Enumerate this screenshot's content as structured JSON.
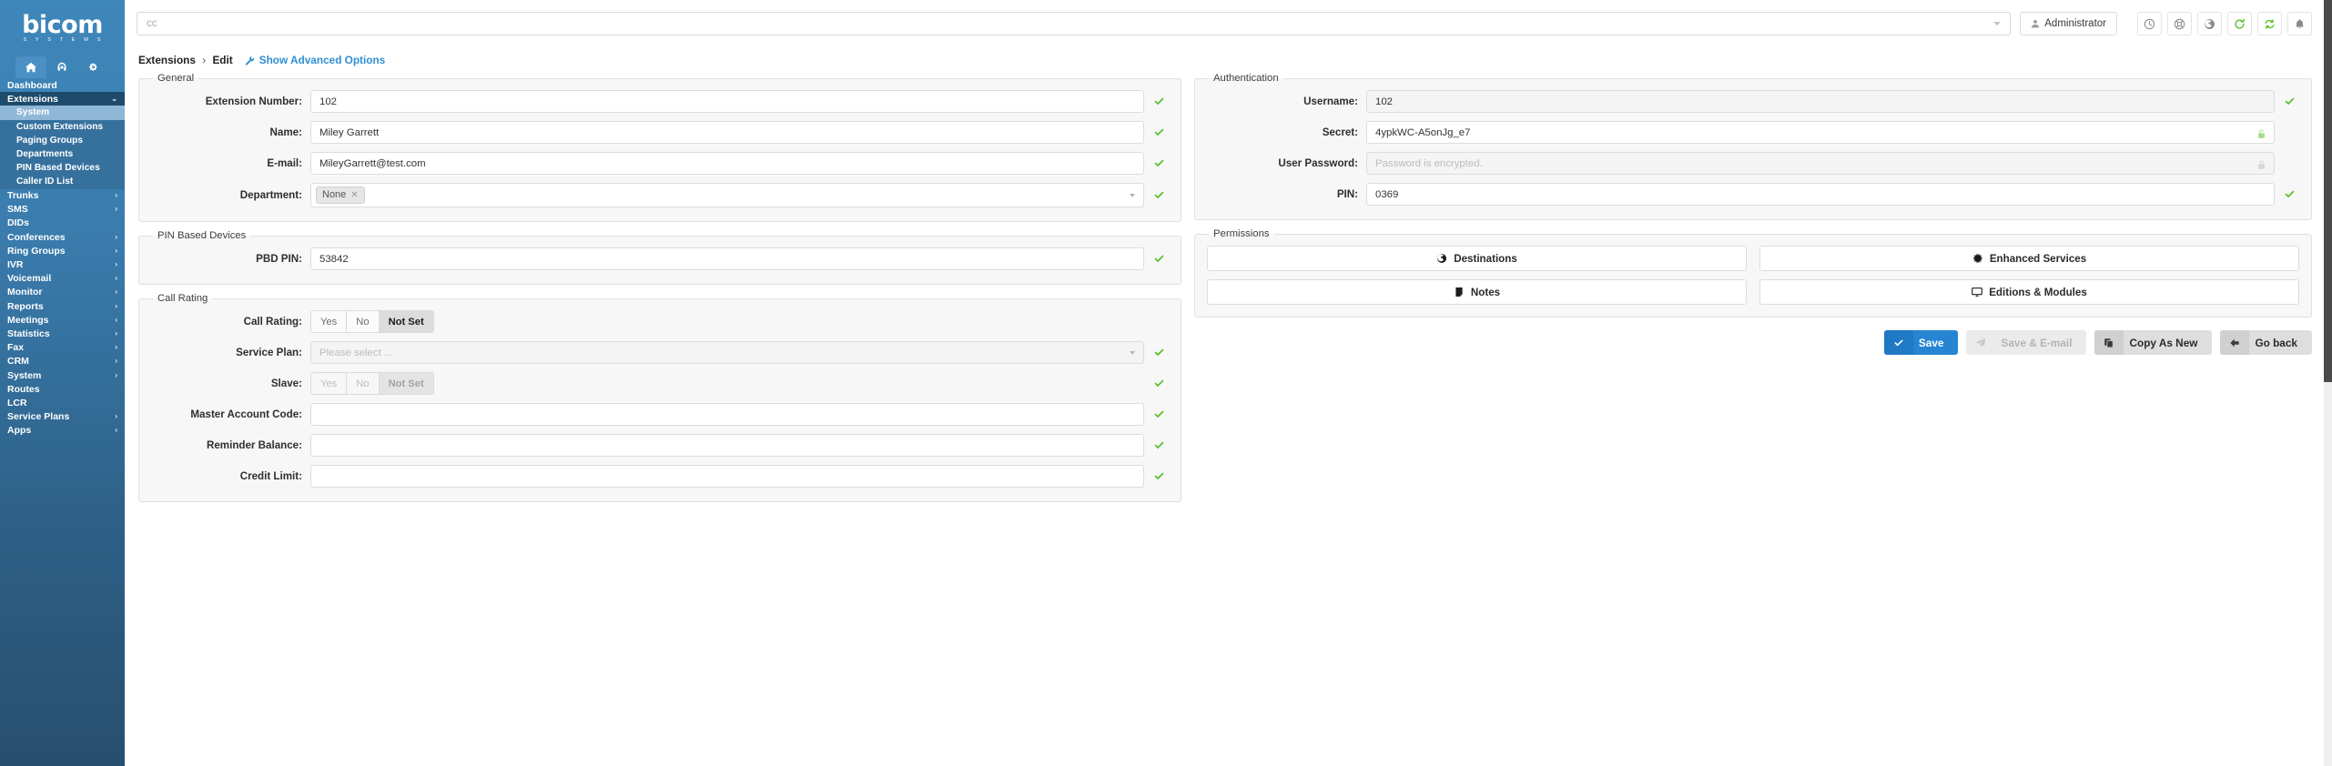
{
  "brand": {
    "name": "bicom",
    "tagline": "S Y S T E M S",
    "accent": "#2585d3",
    "sidebar_color": "#3a7cad",
    "success_color": "#5cbf2a"
  },
  "sidebar": {
    "tabs": [
      {
        "name": "home-tab",
        "icon": "home-icon",
        "active": true
      },
      {
        "name": "headset-tab",
        "icon": "headset-icon",
        "active": false
      },
      {
        "name": "settings-tab",
        "icon": "gears-icon",
        "active": false
      }
    ],
    "items": [
      {
        "label": "Dashboard",
        "expandable": false,
        "state": ""
      },
      {
        "label": "Extensions",
        "expandable": true,
        "state": "expanded",
        "caret": "⌄"
      },
      {
        "label": "System",
        "sub": true,
        "active": true
      },
      {
        "label": "Custom Extensions",
        "sub": true
      },
      {
        "label": "Paging Groups",
        "sub": true
      },
      {
        "label": "Departments",
        "sub": true
      },
      {
        "label": "PIN Based Devices",
        "sub": true
      },
      {
        "label": "Caller ID List",
        "sub": true
      },
      {
        "label": "Trunks",
        "expandable": true,
        "caret": "›"
      },
      {
        "label": "SMS",
        "expandable": true,
        "caret": "›"
      },
      {
        "label": "DIDs",
        "expandable": false
      },
      {
        "label": "Conferences",
        "expandable": true,
        "caret": "›"
      },
      {
        "label": "Ring Groups",
        "expandable": true,
        "caret": "›"
      },
      {
        "label": "IVR",
        "expandable": true,
        "caret": "›"
      },
      {
        "label": "Voicemail",
        "expandable": true,
        "caret": "›"
      },
      {
        "label": "Monitor",
        "expandable": true,
        "caret": "›"
      },
      {
        "label": "Reports",
        "expandable": true,
        "caret": "›"
      },
      {
        "label": "Meetings",
        "expandable": true,
        "caret": "›"
      },
      {
        "label": "Statistics",
        "expandable": true,
        "caret": "›"
      },
      {
        "label": "Fax",
        "expandable": true,
        "caret": "›"
      },
      {
        "label": "CRM",
        "expandable": true,
        "caret": "›"
      },
      {
        "label": "System",
        "expandable": true,
        "caret": "›"
      },
      {
        "label": "Routes",
        "expandable": false
      },
      {
        "label": "LCR",
        "expandable": false
      },
      {
        "label": "Service Plans",
        "expandable": true,
        "caret": "›"
      },
      {
        "label": "Apps",
        "expandable": true,
        "caret": "›"
      }
    ]
  },
  "topbar": {
    "search_placeholder": "cc",
    "user_label": "Administrator",
    "icons": [
      {
        "name": "clock-icon",
        "color": "grey"
      },
      {
        "name": "lifebuoy-icon",
        "color": "grey"
      },
      {
        "name": "globe-icon",
        "color": "grey"
      },
      {
        "name": "reload-icon",
        "color": "green"
      },
      {
        "name": "sync-icon",
        "color": "green"
      },
      {
        "name": "bell-icon",
        "color": "grey"
      }
    ]
  },
  "breadcrumb": {
    "root": "Extensions",
    "separator": "›",
    "current": "Edit",
    "advanced_link": "Show Advanced Options"
  },
  "general": {
    "legend": "General",
    "fields": [
      {
        "label": "Extension Number:",
        "value": "102",
        "type": "text",
        "valid": true
      },
      {
        "label": "Name:",
        "value": "Miley Garrett",
        "type": "text",
        "valid": true
      },
      {
        "label": "E-mail:",
        "value": "MileyGarrett@test.com",
        "type": "text",
        "valid": true
      },
      {
        "label": "Department:",
        "value": "None",
        "type": "tag-select",
        "valid": true
      }
    ]
  },
  "pin_based_devices": {
    "legend": "PIN Based Devices",
    "fields": [
      {
        "label": "PBD PIN:",
        "value": "53842",
        "type": "text",
        "valid": true
      }
    ]
  },
  "call_rating": {
    "legend": "Call Rating",
    "toggle_options": [
      "Yes",
      "No",
      "Not Set"
    ],
    "fields": [
      {
        "label": "Call Rating:",
        "type": "toggle",
        "selected": "Not Set",
        "disabled": false,
        "valid": false
      },
      {
        "label": "Service Plan:",
        "type": "select",
        "placeholder": "Please select ...",
        "valid": true
      },
      {
        "label": "Slave:",
        "type": "toggle",
        "selected": "Not Set",
        "disabled": true,
        "valid": true
      },
      {
        "label": "Master Account Code:",
        "type": "text",
        "value": "",
        "valid": true
      },
      {
        "label": "Reminder Balance:",
        "type": "text",
        "value": "",
        "valid": true
      },
      {
        "label": "Credit Limit:",
        "type": "text",
        "value": "",
        "valid": true
      }
    ]
  },
  "authentication": {
    "legend": "Authentication",
    "fields": [
      {
        "label": "Username:",
        "value": "102",
        "type": "text",
        "readonly": true,
        "valid": true
      },
      {
        "label": "Secret:",
        "value": "4ypkWC-A5onJg_e7",
        "type": "text",
        "lock": "unlocked",
        "valid": false
      },
      {
        "label": "User Password:",
        "value": "",
        "placeholder": "Password is encrypted.",
        "type": "text",
        "readonly": true,
        "lock": "locked",
        "valid": false
      },
      {
        "label": "PIN:",
        "value": "0369",
        "type": "text",
        "valid": true
      }
    ]
  },
  "permissions": {
    "legend": "Permissions",
    "buttons": [
      {
        "label": "Destinations",
        "icon": "globe-icon"
      },
      {
        "label": "Enhanced Services",
        "icon": "gear-icon"
      },
      {
        "label": "Notes",
        "icon": "note-icon"
      },
      {
        "label": "Editions & Modules",
        "icon": "monitor-icon"
      }
    ]
  },
  "actions": [
    {
      "label": "Save",
      "icon": "check-icon",
      "style": "primary",
      "disabled": false
    },
    {
      "label": "Save & E-mail",
      "icon": "send-icon",
      "style": "disabled",
      "disabled": true
    },
    {
      "label": "Copy As New",
      "icon": "copy-icon",
      "style": "secondary",
      "disabled": false
    },
    {
      "label": "Go back",
      "icon": "arrow-left-icon",
      "style": "secondary",
      "disabled": false
    }
  ]
}
